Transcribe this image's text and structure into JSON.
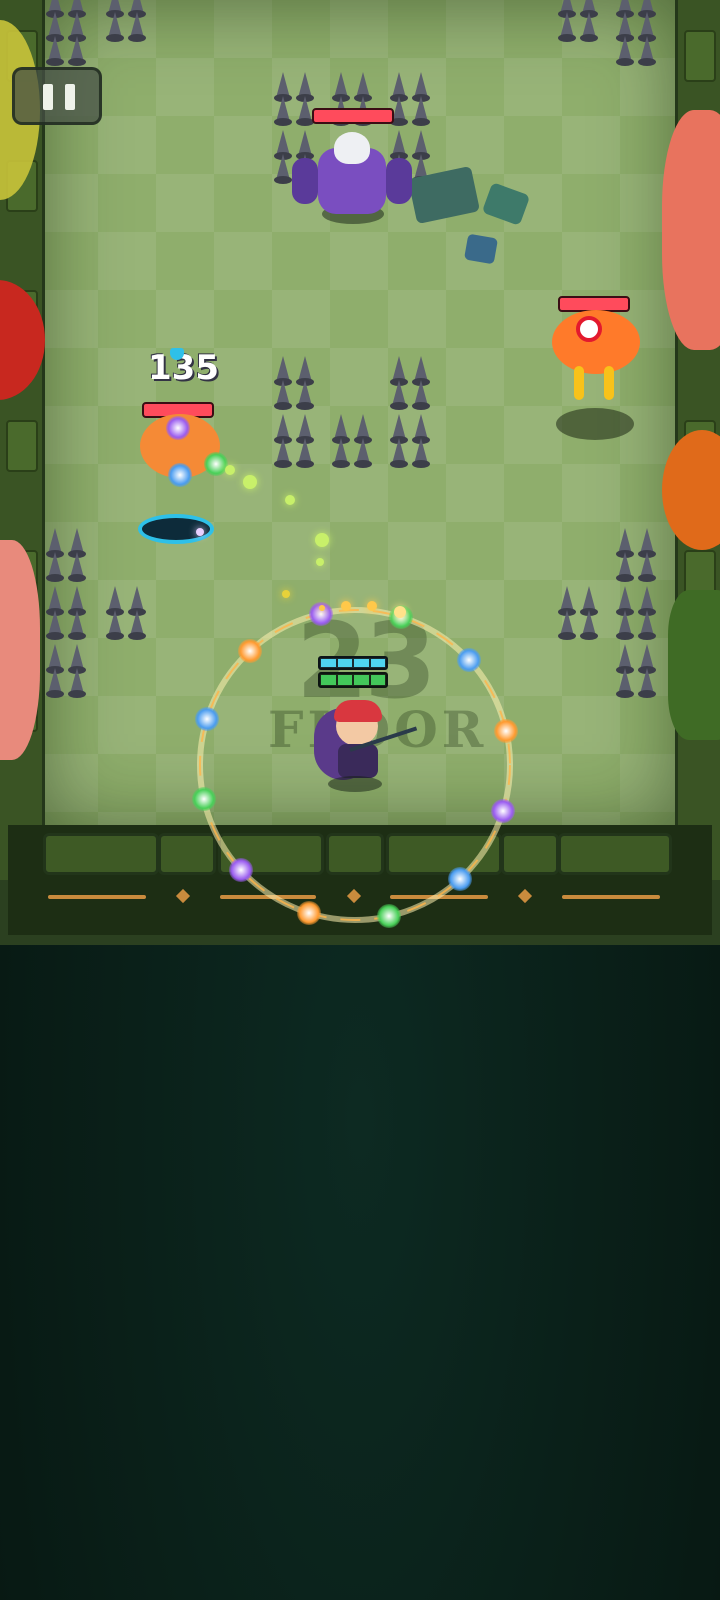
{
  "hud": {
    "damage_number": "135",
    "floor_number": "23",
    "floor_word": "FLOOR"
  },
  "player": {
    "shield_segments": 4,
    "health_segments": 4,
    "shield_color": "#4fd4f0",
    "health_color": "#43c85a"
  },
  "enemies": [
    {
      "type": "skull-brute",
      "hp_fraction": 1.0
    },
    {
      "type": "orange-eye-blob",
      "hp_fraction": 1.0
    },
    {
      "type": "orange-blob",
      "hp_fraction": 0.95
    }
  ],
  "colors": {
    "floor": "#8fae6c",
    "wall": "#3a5424",
    "enemy_hp": "#ff4b5c",
    "accent_orange": "#c98b3d",
    "background": "#0a2019"
  },
  "icons": {
    "pause": "pause-icon",
    "spike": "spike-trap-icon"
  }
}
